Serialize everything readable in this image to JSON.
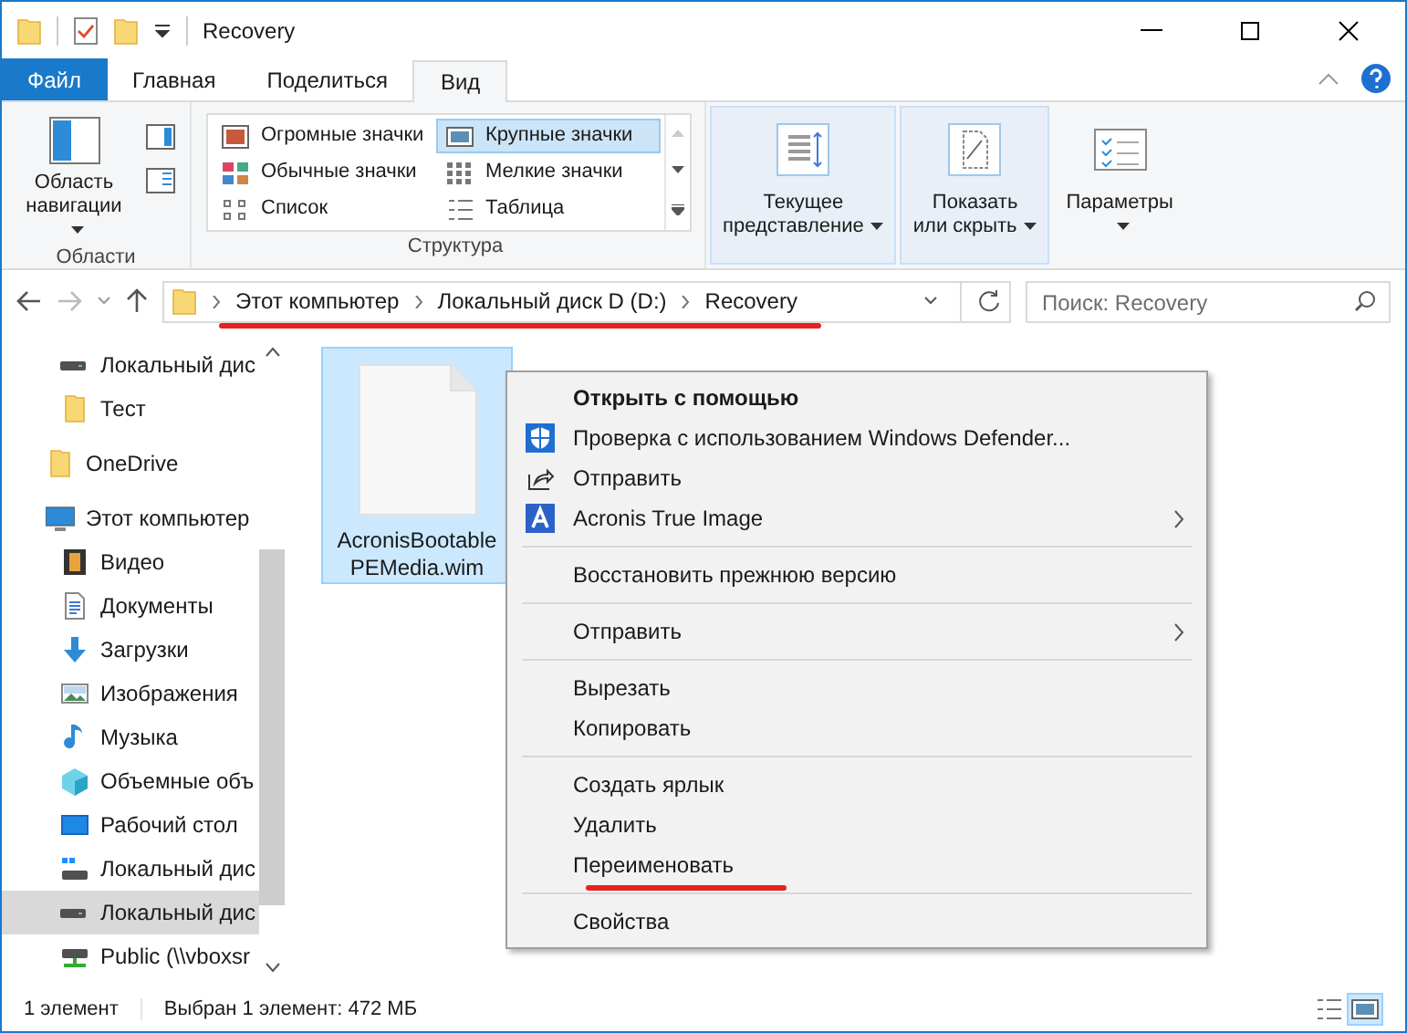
{
  "window": {
    "title": "Recovery"
  },
  "tabs": [
    {
      "label": "Файл",
      "kind": "file",
      "selected": false
    },
    {
      "label": "Главная",
      "kind": "tab",
      "selected": false
    },
    {
      "label": "Поделиться",
      "kind": "tab",
      "selected": false
    },
    {
      "label": "Вид",
      "kind": "tab",
      "selected": true
    }
  ],
  "ribbon": {
    "panes": {
      "label": "Область навигации",
      "group": "Области"
    },
    "layout": {
      "group": "Структура",
      "options": [
        {
          "label": "Огромные значки",
          "selected": false
        },
        {
          "label": "Крупные значки",
          "selected": true
        },
        {
          "label": "Обычные значки",
          "selected": false
        },
        {
          "label": "Мелкие значки",
          "selected": false
        },
        {
          "label": "Список",
          "selected": false
        },
        {
          "label": "Таблица",
          "selected": false
        }
      ]
    },
    "big_buttons": [
      {
        "line1": "Текущее",
        "line2": "представление",
        "highlighted": true
      },
      {
        "line1": "Показать",
        "line2": "или скрыть",
        "highlighted": true
      },
      {
        "line1": "Параметры",
        "highlighted": false
      }
    ]
  },
  "address": {
    "path": [
      "Этот компьютер",
      "Локальный диск D (D:)",
      "Recovery"
    ],
    "search_placeholder": "Поиск: Recovery"
  },
  "sidebar": {
    "items": [
      {
        "label": "Локальный дис",
        "kind": "drive",
        "selected": false,
        "indent": true
      },
      {
        "label": "Тест",
        "kind": "folder",
        "selected": false,
        "indent": true
      },
      {
        "label": "OneDrive",
        "kind": "folder",
        "selected": false,
        "indent": false
      },
      {
        "label": "Этот компьютер",
        "kind": "pc",
        "selected": false,
        "indent": false,
        "children": [
          {
            "label": "Видео",
            "kind": "video",
            "selected": false
          },
          {
            "label": "Документы",
            "kind": "docs",
            "selected": false
          },
          {
            "label": "Загрузки",
            "kind": "download",
            "selected": false
          },
          {
            "label": "Изображения",
            "kind": "image",
            "selected": false
          },
          {
            "label": "Музыка",
            "kind": "music",
            "selected": false
          },
          {
            "label": "Объемные объ",
            "kind": "cube",
            "selected": false
          },
          {
            "label": "Рабочий стол",
            "kind": "desktop",
            "selected": false
          },
          {
            "label": "Локальный дис",
            "kind": "windrive",
            "selected": false
          },
          {
            "label": "Локальный дис",
            "kind": "drive",
            "selected": true
          },
          {
            "label": "Public (\\\\vboxsr",
            "kind": "netdrive",
            "selected": false
          }
        ]
      }
    ]
  },
  "files": [
    {
      "line1": "AcronisBootable",
      "line2": "PEMedia.wim",
      "selected": true
    }
  ],
  "context_menu": [
    {
      "kind": "plain",
      "label": "Открыть с помощью",
      "bold": true,
      "submenu": false
    },
    {
      "kind": "defender",
      "label": "Проверка с использованием Windows Defender...",
      "bold": false,
      "submenu": false
    },
    {
      "kind": "share",
      "label": "Отправить",
      "bold": false,
      "submenu": false
    },
    {
      "kind": "acronis",
      "label": "Acronis True Image",
      "bold": false,
      "submenu": true
    },
    {
      "kind": "separator"
    },
    {
      "kind": "plain",
      "label": "Восстановить прежнюю версию",
      "bold": false,
      "submenu": false
    },
    {
      "kind": "separator"
    },
    {
      "kind": "plain",
      "label": "Отправить",
      "bold": false,
      "submenu": true
    },
    {
      "kind": "separator"
    },
    {
      "kind": "plain",
      "label": "Вырезать",
      "bold": false,
      "submenu": false
    },
    {
      "kind": "plain",
      "label": "Копировать",
      "bold": false,
      "submenu": false
    },
    {
      "kind": "separator"
    },
    {
      "kind": "plain",
      "label": "Создать ярлык",
      "bold": false,
      "submenu": false
    },
    {
      "kind": "plain",
      "label": "Удалить",
      "bold": false,
      "submenu": false
    },
    {
      "kind": "plain",
      "label": "Переименовать",
      "bold": false,
      "submenu": false,
      "underlined": true
    },
    {
      "kind": "separator"
    },
    {
      "kind": "plain",
      "label": "Свойства",
      "bold": false,
      "submenu": false
    }
  ],
  "status_bar": {
    "count": "1 элемент",
    "selection": "Выбран 1 элемент: 472 МБ",
    "view_buttons": [
      {
        "selected": false
      },
      {
        "selected": true
      }
    ]
  }
}
